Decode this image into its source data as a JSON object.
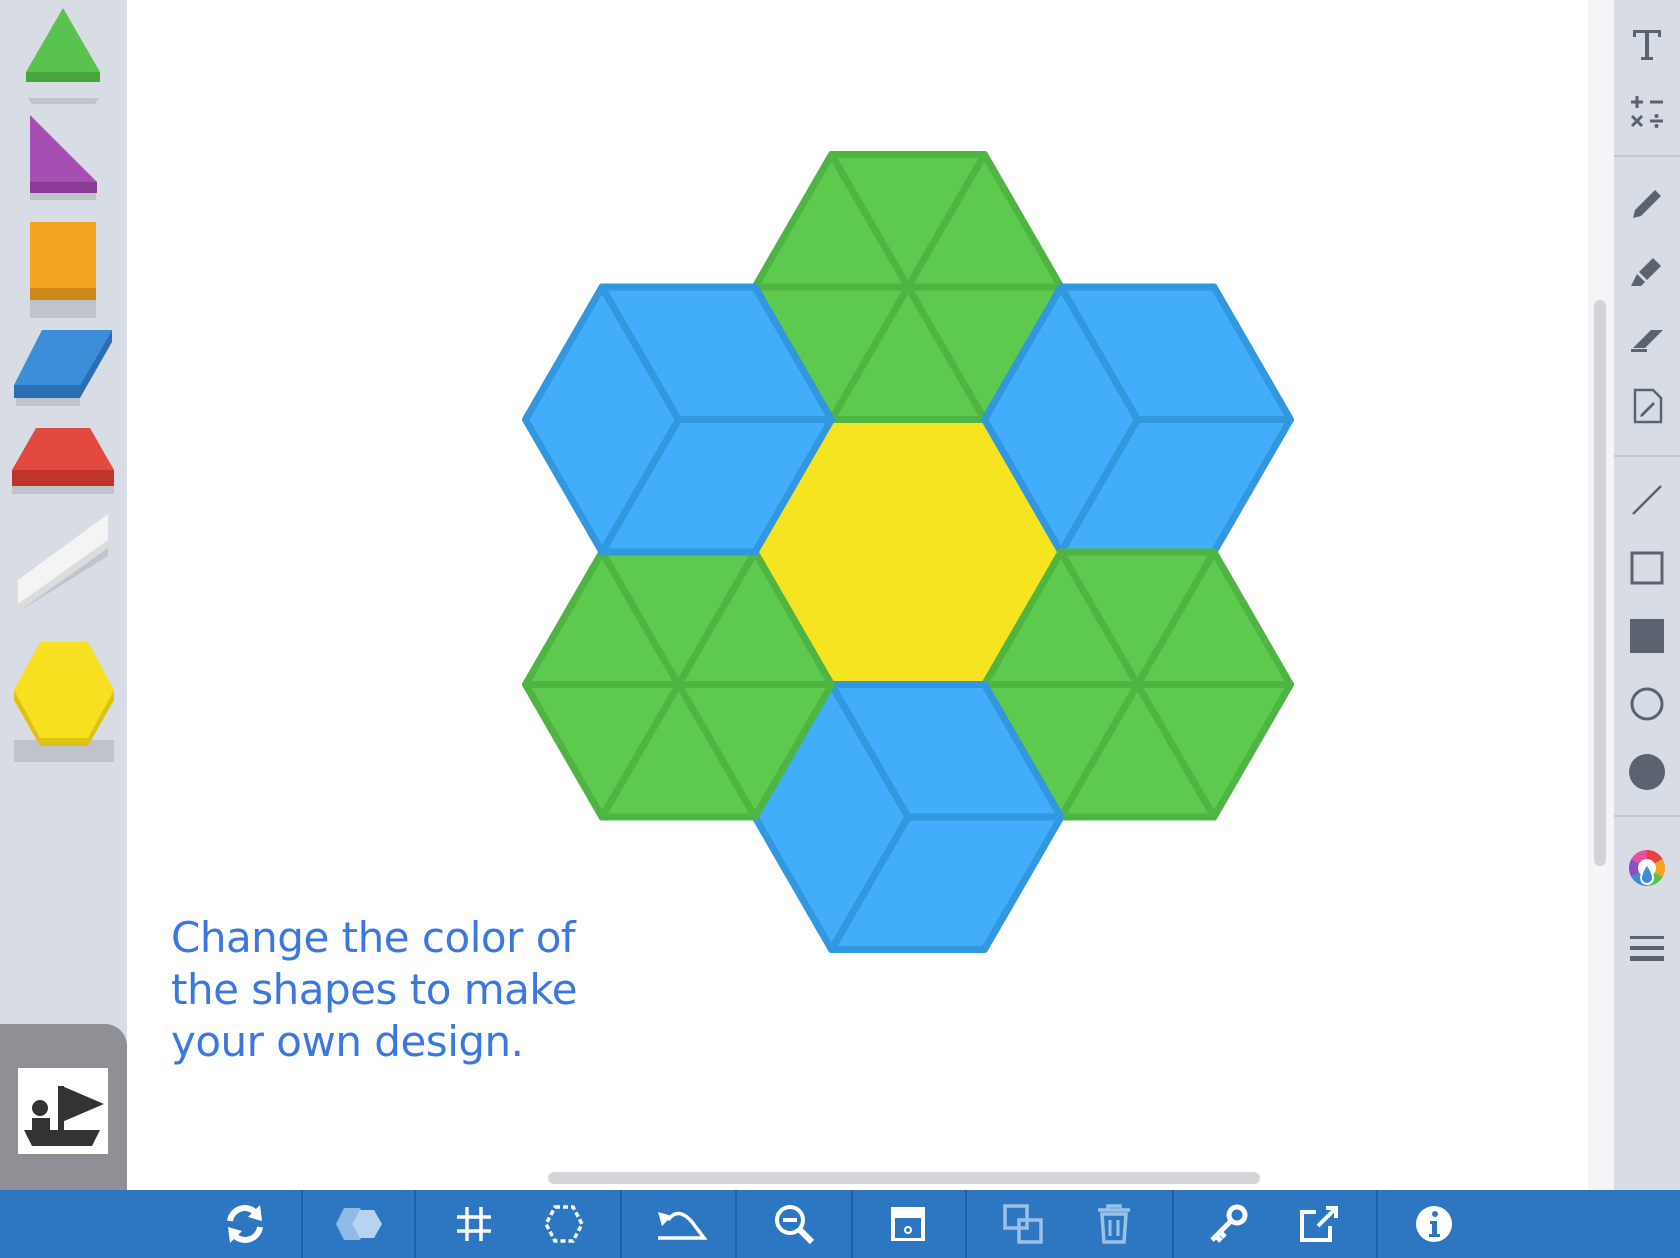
{
  "instruction": {
    "line1": "Change the color of",
    "line2": "the shapes to make",
    "line3": "your own design."
  },
  "palette": {
    "shapes": [
      {
        "name": "green-triangle",
        "color": "#5ac24e"
      },
      {
        "name": "purple-right-triangle",
        "color": "#a54fb3"
      },
      {
        "name": "orange-square",
        "color": "#f2a31f"
      },
      {
        "name": "blue-rhombus",
        "color": "#3d8ed8"
      },
      {
        "name": "red-trapezoid",
        "color": "#e24a3f"
      },
      {
        "name": "white-thin-rhombus",
        "color": "#f4f4f4"
      },
      {
        "name": "yellow-hexagon",
        "color": "#f7e020"
      }
    ]
  },
  "colors": {
    "canvas_green": "#5ec94f",
    "canvas_green_stroke": "#4fb542",
    "canvas_blue": "#42adfa",
    "canvas_blue_stroke": "#3197df",
    "canvas_yellow": "#f7e420",
    "canvas_yellow_stroke": "#ead41a",
    "toolbar": "#2d77c2",
    "instruction_text": "#3a78e0"
  },
  "right_tools": [
    {
      "id": "text",
      "icon": "text-icon"
    },
    {
      "id": "math",
      "icon": "math-operators-icon"
    },
    {
      "id": "pencil",
      "icon": "pencil-icon"
    },
    {
      "id": "highlighter",
      "icon": "highlighter-icon"
    },
    {
      "id": "eraser",
      "icon": "eraser-icon"
    },
    {
      "id": "note",
      "icon": "note-icon"
    },
    {
      "id": "line",
      "icon": "line-icon"
    },
    {
      "id": "rect-outline",
      "icon": "rectangle-outline-icon"
    },
    {
      "id": "rect-filled",
      "icon": "rectangle-filled-icon"
    },
    {
      "id": "circle-outline",
      "icon": "circle-outline-icon"
    },
    {
      "id": "circle-filled",
      "icon": "circle-filled-icon"
    },
    {
      "id": "color",
      "icon": "color-wheel-icon"
    },
    {
      "id": "line-weight",
      "icon": "line-weight-icon"
    }
  ],
  "bottom_tools": [
    {
      "id": "rotate",
      "icon": "rotate-icon"
    },
    {
      "id": "combine",
      "icon": "combine-shapes-icon"
    },
    {
      "id": "grid",
      "icon": "grid-icon"
    },
    {
      "id": "outline",
      "icon": "outline-shape-icon"
    },
    {
      "id": "undo",
      "icon": "undo-icon"
    },
    {
      "id": "zoom-out",
      "icon": "zoom-out-icon"
    },
    {
      "id": "cover",
      "icon": "screen-cover-icon"
    },
    {
      "id": "duplicate",
      "icon": "duplicate-icon"
    },
    {
      "id": "delete",
      "icon": "trash-icon"
    },
    {
      "id": "lock",
      "icon": "key-icon"
    },
    {
      "id": "share",
      "icon": "share-icon"
    },
    {
      "id": "info",
      "icon": "info-icon"
    }
  ]
}
